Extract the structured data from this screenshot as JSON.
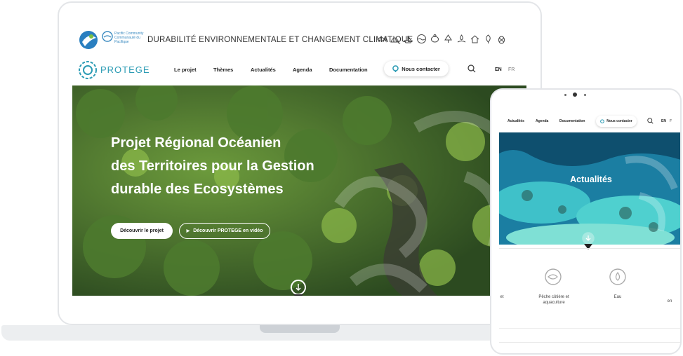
{
  "laptop": {
    "top_bar": {
      "org_name": "Pacific Community Communauté du Pacifique",
      "site_title": "DURABILITÉ ENVIRONNEMENTALE ET CHANGEMENT CLIMATIQUE",
      "sector_icons": [
        "fish-icon",
        "shell-icon",
        "boat-icon",
        "wave-icon",
        "turtle-icon",
        "tree-icon",
        "water-hand-icon",
        "house-icon",
        "leaf-icon",
        "pineapple-icon"
      ]
    },
    "nav": {
      "brand": "PROTEGE",
      "items": [
        "Le projet",
        "Thèmes",
        "Actualités",
        "Agenda",
        "Documentation"
      ],
      "contact_label": "Nous contacter",
      "lang_en": "EN",
      "lang_fr": "FR"
    },
    "hero": {
      "title_line1": "Projet Régional Océanien",
      "title_line2": "des Territoires pour la Gestion",
      "title_line3": "durable des Ecosystèmes",
      "btn_project": "Découvrir le projet",
      "btn_video": "Découvrir PROTEGE en vidéo"
    }
  },
  "tablet": {
    "nav": {
      "items": [
        "Actualités",
        "Agenda",
        "Documentation"
      ],
      "contact_label": "Nous contacter",
      "lang_en": "EN",
      "lang_fr": "F"
    },
    "hero": {
      "title": "Actualités"
    },
    "themes": {
      "left_partial": "et",
      "fishing_line1": "Pêche côtière et",
      "fishing_line2": "aquaculture",
      "water": "Eau",
      "right_partial": "en"
    }
  },
  "colors": {
    "brand": "#2b9bb4",
    "accent_dark": "#222222"
  }
}
